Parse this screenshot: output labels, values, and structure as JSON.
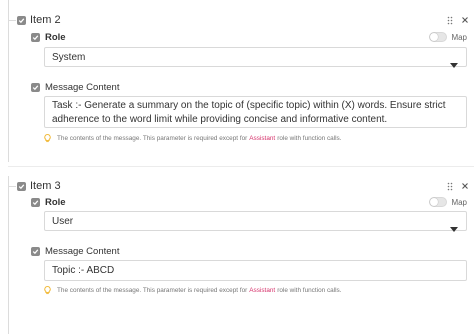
{
  "items": [
    {
      "title": "Item 2",
      "role_label": "Role",
      "map_label": "Map",
      "role_value": "System",
      "content_label": "Message Content",
      "content_value": "Task :- Generate a summary on the topic of (specific topic) within (X) words. Ensure strict adherence to the word limit while providing concise and informative content.",
      "hint_before": "The contents of the message. This parameter is required except for",
      "hint_tag": "Assistant",
      "hint_after": "role with function calls."
    },
    {
      "title": "Item 3",
      "role_label": "Role",
      "map_label": "Map",
      "role_value": "User",
      "content_label": "Message Content",
      "content_value": "Topic :- ABCD",
      "hint_before": "The contents of the message. This parameter is required except for",
      "hint_tag": "Assistant",
      "hint_after": "role with function calls."
    }
  ],
  "colors": {
    "accent_tag": "#d6336c",
    "bulb": "#f0b429"
  },
  "icons": [
    "checkbox-icon",
    "drag-handle-icon",
    "close-icon",
    "chevron-down-icon",
    "lightbulb-icon"
  ]
}
